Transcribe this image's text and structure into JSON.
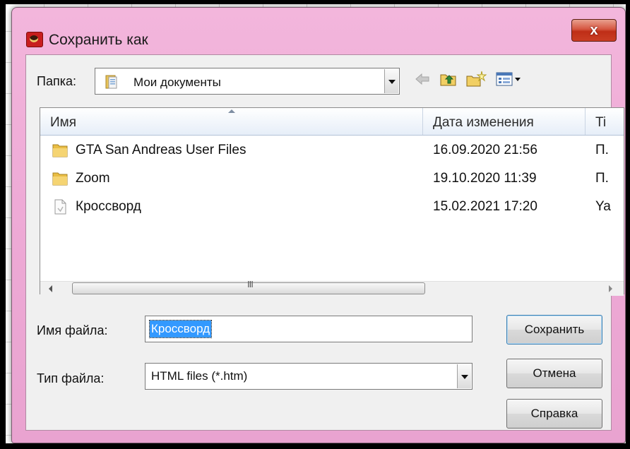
{
  "window": {
    "title": "Сохранить как",
    "close_label": "x"
  },
  "folder": {
    "label": "Папка:",
    "current": "Мои документы"
  },
  "toolbar": {
    "icons": [
      "back-arrow-icon",
      "up-folder-icon",
      "new-folder-icon",
      "view-menu-icon"
    ]
  },
  "columns": [
    "Имя",
    "Дата изменения",
    "Ti"
  ],
  "files": [
    {
      "name": "GTA San Andreas User Files",
      "date": "16.09.2020 21:56",
      "type": "П.",
      "icon": "folder-icon"
    },
    {
      "name": "Zoom",
      "date": "19.10.2020 11:39",
      "type": "П.",
      "icon": "folder-icon"
    },
    {
      "name": "Кроссворд",
      "date": "15.02.2021 17:20",
      "type": "Ya",
      "icon": "document-icon"
    }
  ],
  "scrollbar": {
    "grip": "III"
  },
  "filename": {
    "label": "Имя файла:",
    "value": "Кроссворд"
  },
  "filetype": {
    "label": "Тип файла:",
    "value": "HTML files (*.htm)"
  },
  "buttons": {
    "save": "Сохранить",
    "cancel": "Отмена",
    "help": "Справка"
  },
  "colors": {
    "title_bar": "#eeaad6",
    "close_button": "#c93d23",
    "selection": "#3399ff"
  }
}
